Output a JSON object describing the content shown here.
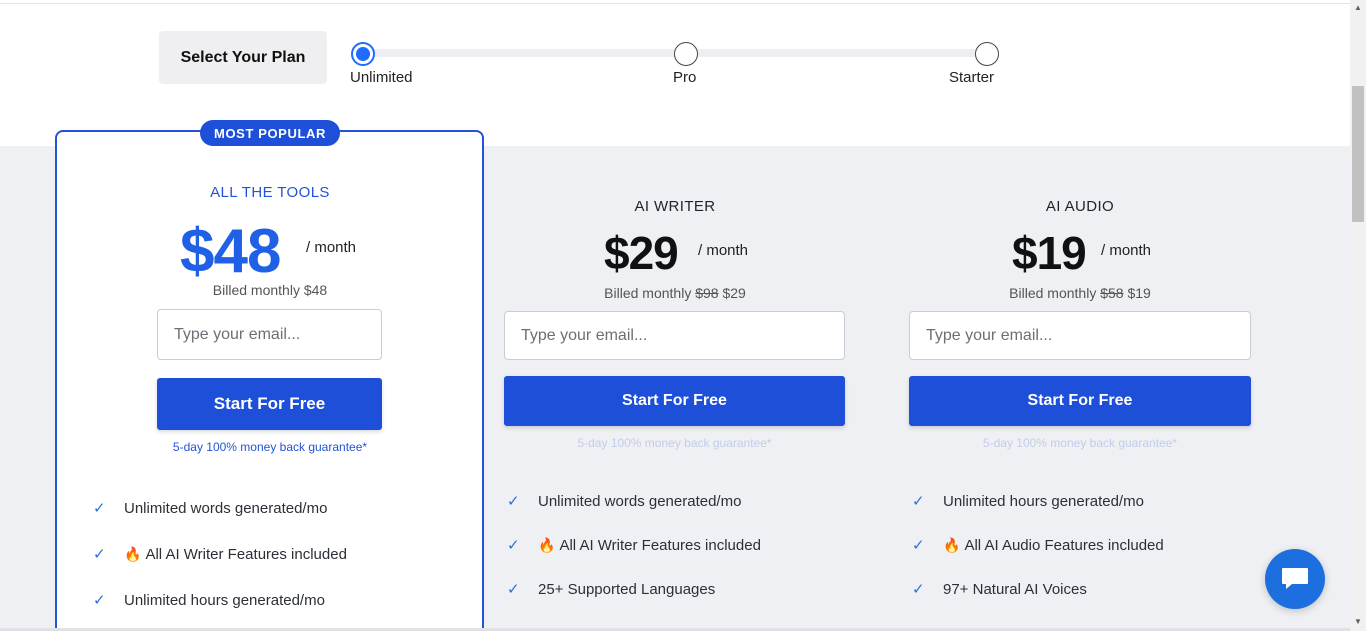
{
  "selector": {
    "title": "Select Your Plan",
    "options": [
      {
        "label": "Unlimited",
        "selected": true
      },
      {
        "label": "Pro",
        "selected": false
      },
      {
        "label": "Starter",
        "selected": false
      }
    ]
  },
  "colors": {
    "accent": "#1d4fd8",
    "radio_selected": "#1f6bff",
    "check": "#2b6fe0",
    "background_section": "#eff0f3"
  },
  "plans": [
    {
      "badge": "MOST POPULAR",
      "name": "ALL THE TOOLS",
      "price": "$48",
      "period": "/ month",
      "billed_prefix": "Billed monthly",
      "billed_old": "",
      "billed_new": "$48",
      "email_placeholder": "Type your email...",
      "cta": "Start For Free",
      "guarantee": "5-day 100% money back guarantee*",
      "features": [
        {
          "icon": "check-icon",
          "flame": false,
          "text": "Unlimited words generated/mo"
        },
        {
          "icon": "check-icon",
          "flame": true,
          "text": "All AI Writer Features included"
        },
        {
          "icon": "check-icon",
          "flame": false,
          "text": "Unlimited hours generated/mo"
        }
      ]
    },
    {
      "name": "AI WRITER",
      "price": "$29",
      "period": "/ month",
      "billed_prefix": "Billed monthly",
      "billed_old": "$98",
      "billed_new": "$29",
      "email_placeholder": "Type your email...",
      "cta": "Start For Free",
      "guarantee": "5-day 100% money back guarantee*",
      "features": [
        {
          "icon": "check-icon",
          "flame": false,
          "text": "Unlimited words generated/mo"
        },
        {
          "icon": "check-icon",
          "flame": true,
          "text": "All AI Writer Features included"
        },
        {
          "icon": "check-icon",
          "flame": false,
          "text": "25+ Supported Languages"
        }
      ]
    },
    {
      "name": "AI AUDIO",
      "price": "$19",
      "period": "/ month",
      "billed_prefix": "Billed monthly",
      "billed_old": "$58",
      "billed_new": "$19",
      "email_placeholder": "Type your email...",
      "cta": "Start For Free",
      "guarantee": "5-day 100% money back guarantee*",
      "features": [
        {
          "icon": "check-icon",
          "flame": false,
          "text": "Unlimited hours generated/mo"
        },
        {
          "icon": "check-icon",
          "flame": true,
          "text": "All AI Audio Features included"
        },
        {
          "icon": "check-icon",
          "flame": false,
          "text": "97+ Natural AI Voices"
        }
      ]
    }
  ],
  "chat": {
    "icon": "chat-bubble-icon"
  }
}
